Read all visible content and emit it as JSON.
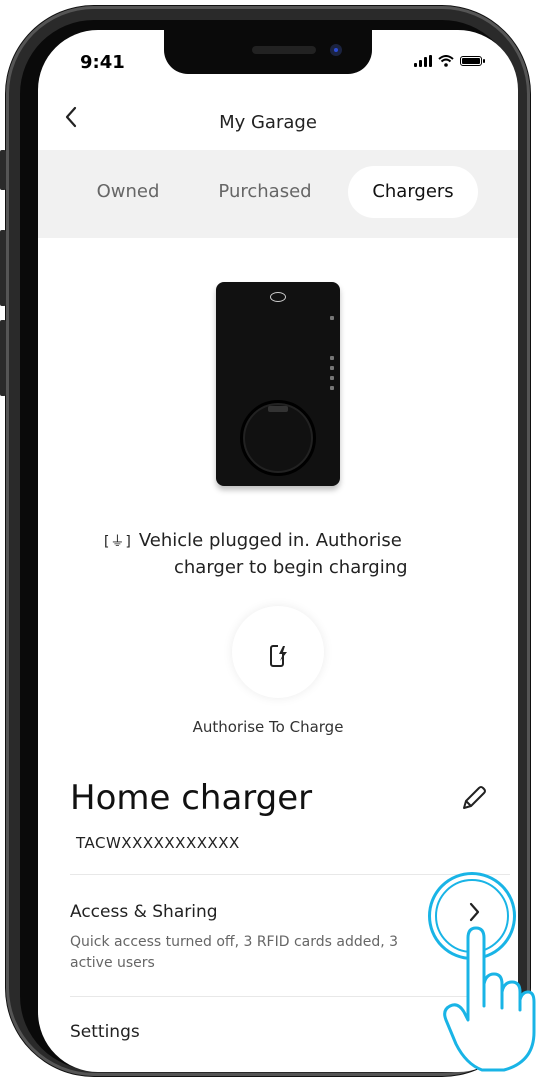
{
  "status_bar": {
    "time": "9:41"
  },
  "header": {
    "title": "My Garage",
    "back_icon": "chevron-left-icon"
  },
  "tabs": [
    {
      "label": "Owned",
      "active": false
    },
    {
      "label": "Purchased",
      "active": false
    },
    {
      "label": "Chargers",
      "active": true
    }
  ],
  "charger_status": {
    "line1": "Vehicle plugged in. Authorise",
    "line2": "charger to begin charging",
    "icon": "plugged-in-icon"
  },
  "authorise": {
    "label": "Authorise To Charge",
    "icon": "phone-charge-icon"
  },
  "charger": {
    "name": "Home charger",
    "id": "TACWXXXXXXXXXXX"
  },
  "access_sharing": {
    "title": "Access & Sharing",
    "subtitle": "Quick access turned off, 3 RFID cards added, 3 active users"
  },
  "settings": {
    "title": "Settings"
  },
  "colors": {
    "highlight": "#19b4e6",
    "tab_bg": "#f1f1f1",
    "text": "#222222"
  }
}
